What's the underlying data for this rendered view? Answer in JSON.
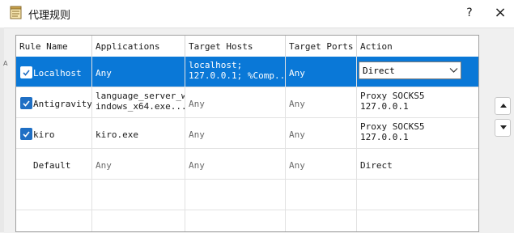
{
  "window": {
    "title": "代理规则",
    "help_label": "?",
    "close_label": "×"
  },
  "left_stub": {
    "letter": "A"
  },
  "table": {
    "columns": [
      "Rule Name",
      "Applications",
      "Target Hosts",
      "Target Ports",
      "Action"
    ],
    "rows": [
      {
        "checked": true,
        "name": "Localhost",
        "applications": "Any",
        "hosts": "localhost;\n127.0.0.1; %Comp...",
        "ports": "Any",
        "action": "Direct",
        "selected": true
      },
      {
        "checked": true,
        "name": "Antigravity",
        "applications": "language_server_w\nindows_x64.exe...",
        "hosts": "Any",
        "ports": "Any",
        "action": "Proxy SOCKS5\n127.0.0.1",
        "selected": false
      },
      {
        "checked": true,
        "name": "kiro",
        "applications": "kiro.exe",
        "hosts": "Any",
        "ports": "Any",
        "action": "Proxy SOCKS5\n127.0.0.1",
        "selected": false
      },
      {
        "checked": false,
        "name": "Default",
        "applications": "Any",
        "hosts": "Any",
        "ports": "Any",
        "action": "Direct",
        "selected": false
      }
    ]
  },
  "colors": {
    "selection": "#0a78d7",
    "checkbox": "#1f6fc4",
    "muted_text": "#6b6b6b"
  },
  "icons": {
    "app": "notepad-icon",
    "move_up": "triangle-up-icon",
    "move_down": "triangle-down-icon",
    "dropdown": "chevron-down-icon"
  }
}
